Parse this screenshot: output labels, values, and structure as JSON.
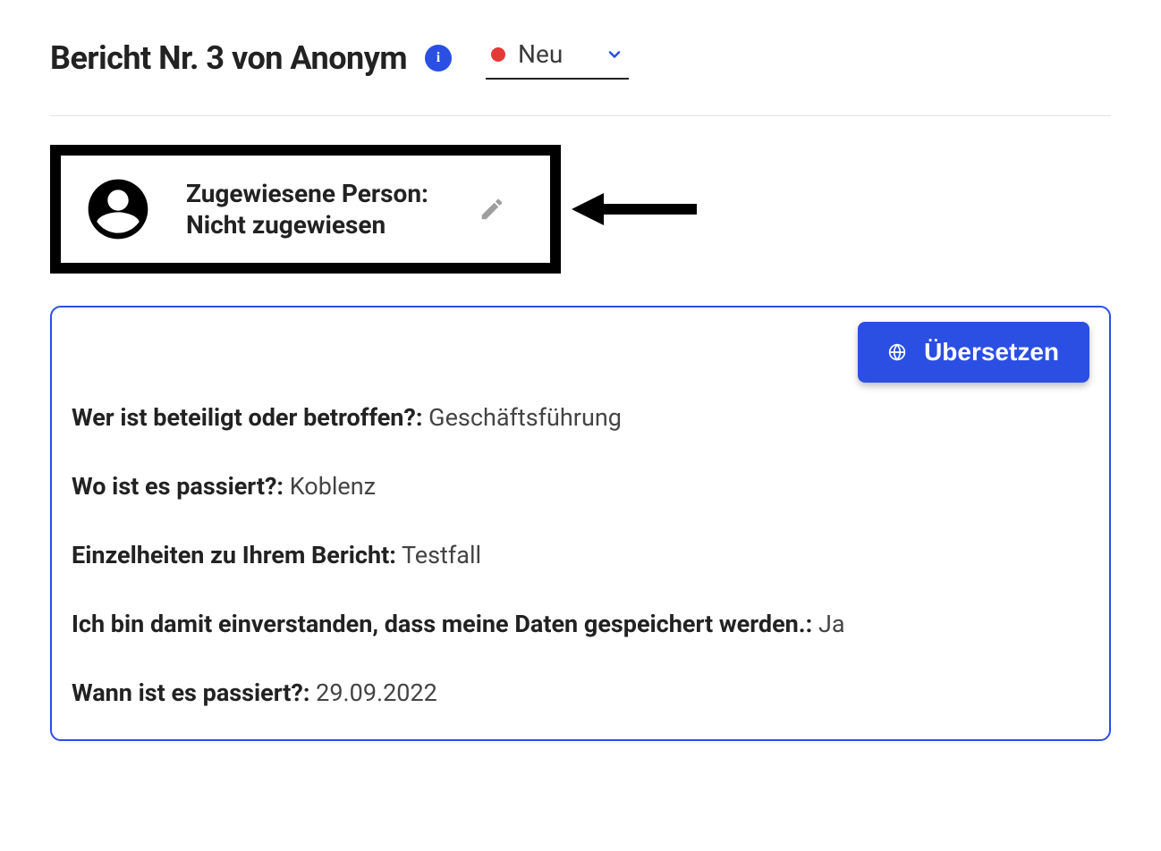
{
  "header": {
    "title": "Bericht Nr. 3 von Anonym",
    "status_label": "Neu",
    "status_color": "#e53935"
  },
  "assigned": {
    "label": "Zugewiesene Person:",
    "value": "Nicht zugewiesen"
  },
  "translate_button_label": "Übersetzen",
  "details": [
    {
      "label": "Wer ist beteiligt oder betroffen?:",
      "value": "Geschäftsführung"
    },
    {
      "label": "Wo ist es passiert?:",
      "value": "Koblenz"
    },
    {
      "label": "Einzelheiten zu Ihrem Bericht:",
      "value": "Testfall"
    },
    {
      "label": "Ich bin damit einverstanden, dass meine Daten gespeichert werden.:",
      "value": "Ja"
    },
    {
      "label": "Wann ist es passiert?:",
      "value": "29.09.2022"
    }
  ]
}
